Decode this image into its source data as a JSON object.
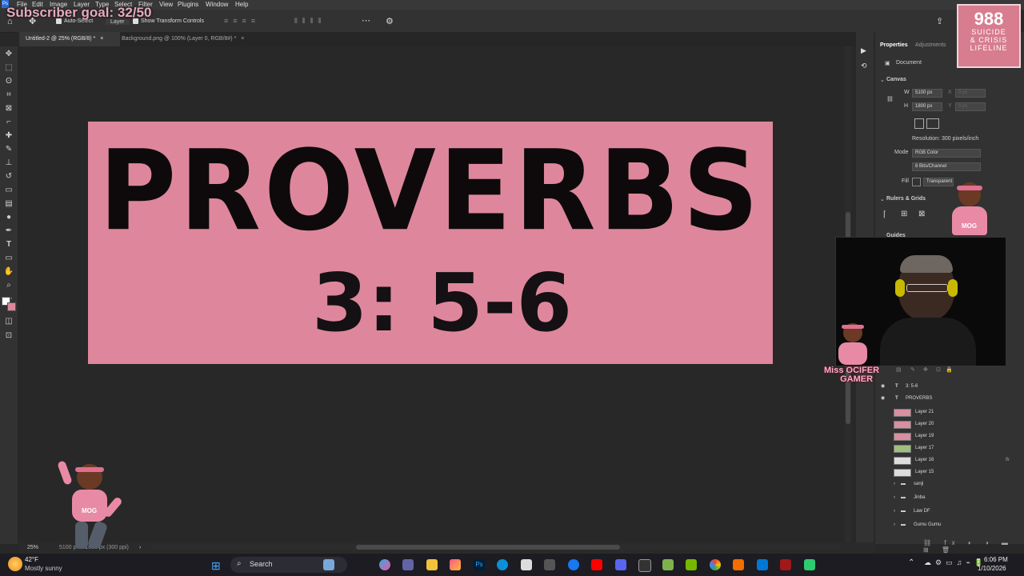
{
  "menu": {
    "items": [
      "File",
      "Edit",
      "Image",
      "Layer",
      "Type",
      "Select",
      "Filter",
      "View",
      "Plugins",
      "Window",
      "Help"
    ]
  },
  "options_bar": {
    "auto_select_label": "Auto-Select",
    "auto_select_target": "Layer",
    "show_transform_label": "Show Transform Controls",
    "more_icon": "more-icon",
    "settings_icon": "gear-icon",
    "share_icon": "share-icon"
  },
  "tabs": [
    {
      "label": "Untitled-2 @ 25% (RGB/8) *",
      "active": true
    },
    {
      "label": "Background.png @ 100% (Layer 0, RGB/8#) *",
      "active": false
    }
  ],
  "canvas": {
    "title": "PROVERBS",
    "verse": "3: 5-6",
    "background_color": "#de879c"
  },
  "properties": {
    "tab_properties": "Properties",
    "tab_adjustments": "Adjustments",
    "document_label": "Document",
    "canvas_section": "Canvas",
    "w_label": "W",
    "w_value": "5100 px",
    "h_label": "H",
    "h_value": "1800 px",
    "x_label": "X",
    "x_placeholder": "0 px",
    "y_label": "Y",
    "y_placeholder": "0 px",
    "resolution": "Resolution: 300 pixels/inch",
    "mode_label": "Mode",
    "mode_value": "RGB Color",
    "depth_value": "8 Bits/Channel",
    "fill_label": "Fill",
    "fill_value": "Transparent",
    "rulers_section": "Rulers & Grids",
    "guides_section": "Guides"
  },
  "layers": [
    {
      "name": "3: 5-6",
      "type": "text",
      "visible": true
    },
    {
      "name": "PROVERBS",
      "type": "text",
      "visible": true
    },
    {
      "name": "Layer 21",
      "type": "image"
    },
    {
      "name": "Layer 20",
      "type": "image"
    },
    {
      "name": "Layer 19",
      "type": "image"
    },
    {
      "name": "Layer 17",
      "type": "image"
    },
    {
      "name": "Layer 16",
      "type": "image",
      "fx": "fx"
    },
    {
      "name": "Layer 15",
      "type": "image"
    },
    {
      "name": "sanji",
      "type": "group"
    },
    {
      "name": "Jinba",
      "type": "group"
    },
    {
      "name": "Law DF",
      "type": "group"
    },
    {
      "name": "Gumu Gumu",
      "type": "group"
    }
  ],
  "status_bar": {
    "zoom": "25%",
    "doc_info": "5100 px x 1800 px (300 ppi)"
  },
  "taskbar": {
    "weather_temp": "42°F",
    "weather_desc": "Mostly sunny",
    "search_placeholder": "Search",
    "time": "6:06 PM",
    "date": "1/10/2026"
  },
  "overlays": {
    "subscriber_goal": "Subscriber goal: 32/50",
    "lifeline_number": "988",
    "lifeline_line1": "SUICIDE",
    "lifeline_line2": "& CRISIS",
    "lifeline_line3": "LIFELINE",
    "streamer_line1": "Miss OCIFER",
    "streamer_line2": "GAMER",
    "avatar_badge": "MOG"
  },
  "colors": {
    "accent_pink": "#de879c",
    "lifeline_bg": "#d77d8f"
  }
}
